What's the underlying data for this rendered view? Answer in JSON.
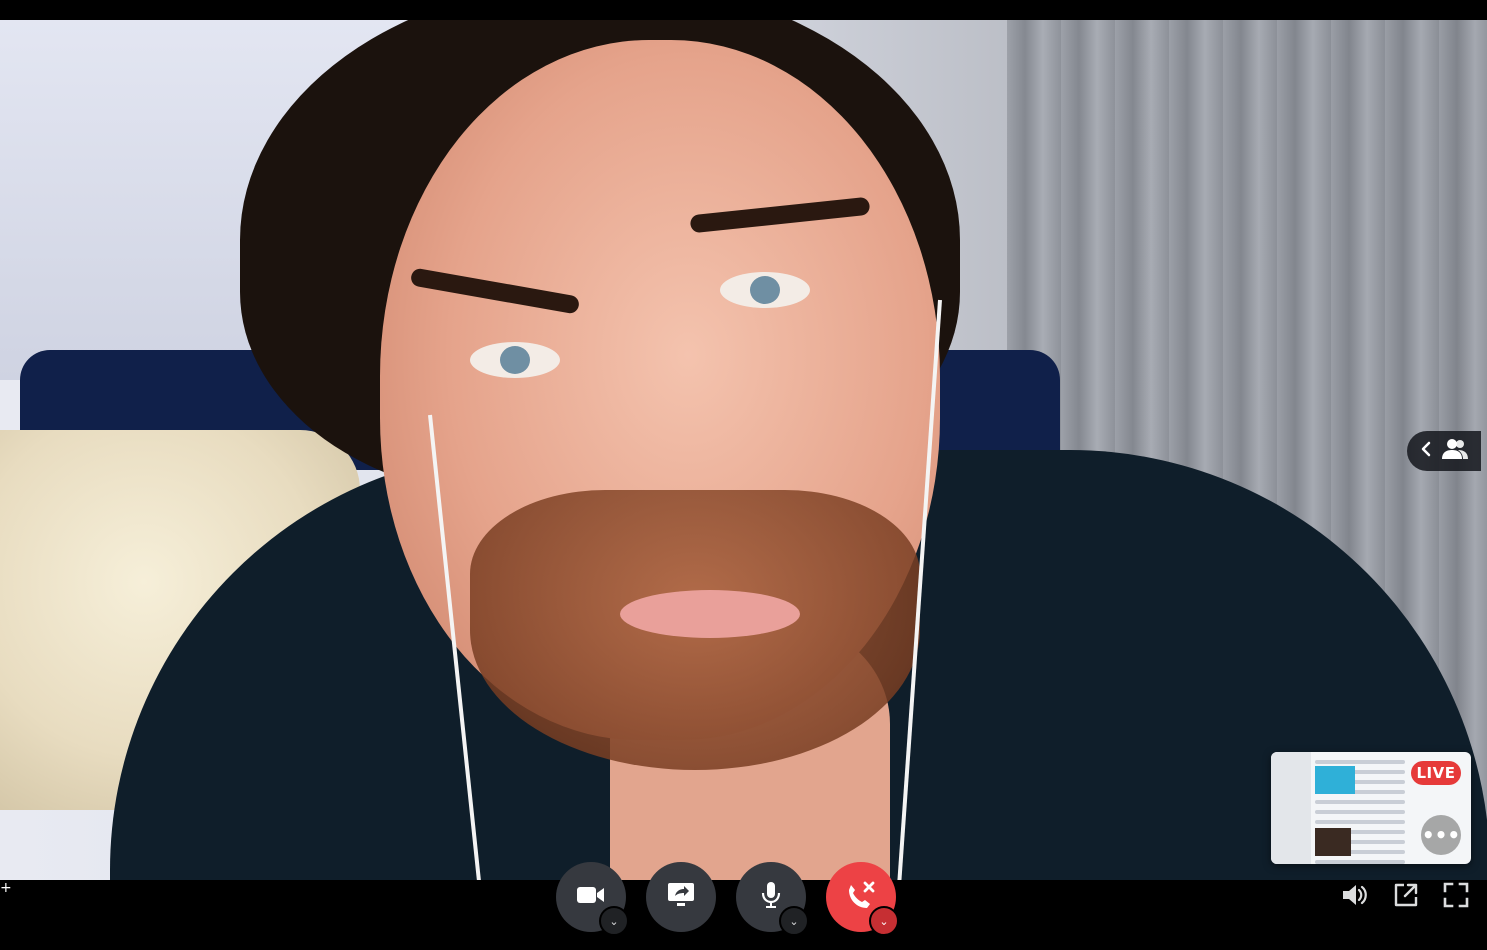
{
  "stage": {
    "participant_video": "participant-video"
  },
  "participants_toggle": {
    "icons": [
      "chevron-left-icon",
      "people-icon"
    ]
  },
  "pip": {
    "live_label": "LIVE",
    "more_icon": "more-icon",
    "more_label": "•••"
  },
  "controls": {
    "camera": {
      "icon": "camera-icon"
    },
    "screen_share": {
      "icon": "screen-share-icon"
    },
    "microphone": {
      "icon": "microphone-icon"
    },
    "disconnect": {
      "icon": "hangup-icon",
      "color": "#ed4245"
    },
    "caret_label": "⌄",
    "add_label": "+"
  },
  "right_controls": {
    "volume": {
      "icon": "volume-icon"
    },
    "popout": {
      "icon": "popout-icon"
    },
    "fullscreen": {
      "icon": "fullscreen-icon"
    }
  },
  "colors": {
    "bar_background": "#000000",
    "button_background": "#36393f",
    "danger": "#ed4245",
    "live_badge": "#e63a3a"
  }
}
